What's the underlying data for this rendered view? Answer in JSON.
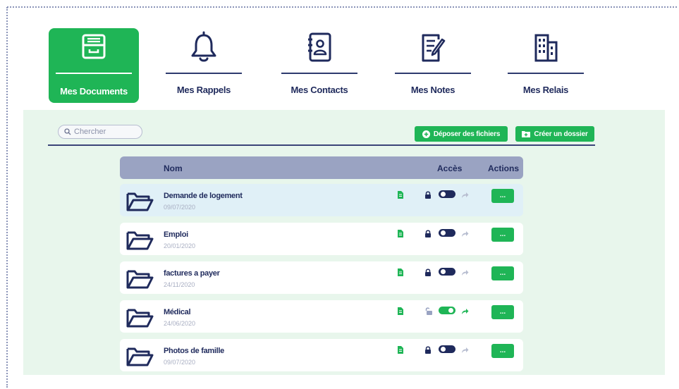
{
  "tabs": [
    {
      "label": "Mes Documents",
      "icon": "document-drawer-icon"
    },
    {
      "label": "Mes Rappels",
      "icon": "bell-icon"
    },
    {
      "label": "Mes Contacts",
      "icon": "address-book-icon"
    },
    {
      "label": "Mes Notes",
      "icon": "notes-pencil-icon"
    },
    {
      "label": "Mes Relais",
      "icon": "building-icon"
    }
  ],
  "toolbar": {
    "search_placeholder": "Chercher",
    "upload_label": "Déposer des fichiers",
    "create_folder_label": "Créer un dossier"
  },
  "table": {
    "columns": [
      "Nom",
      "Accès",
      "Actions"
    ],
    "rows": [
      {
        "name": "Demande de logement",
        "date": "09/07/2020",
        "access_locked": true,
        "access_enabled": false,
        "shared": false,
        "action": "..."
      },
      {
        "name": "Emploi",
        "date": "20/01/2020",
        "access_locked": true,
        "access_enabled": false,
        "shared": false,
        "action": "..."
      },
      {
        "name": "factures a payer",
        "date": "24/11/2020",
        "access_locked": true,
        "access_enabled": false,
        "shared": false,
        "action": "..."
      },
      {
        "name": "Médical",
        "date": "24/06/2020",
        "access_locked": false,
        "access_enabled": true,
        "shared": true,
        "action": "..."
      },
      {
        "name": "Photos de famille",
        "date": "09/07/2020",
        "access_locked": true,
        "access_enabled": false,
        "shared": false,
        "action": "..."
      }
    ]
  },
  "colors": {
    "green": "#1fb556",
    "navy": "#1f2a5c",
    "panel_bg": "#e8f6ec",
    "header_bg": "#9aa3c2"
  }
}
